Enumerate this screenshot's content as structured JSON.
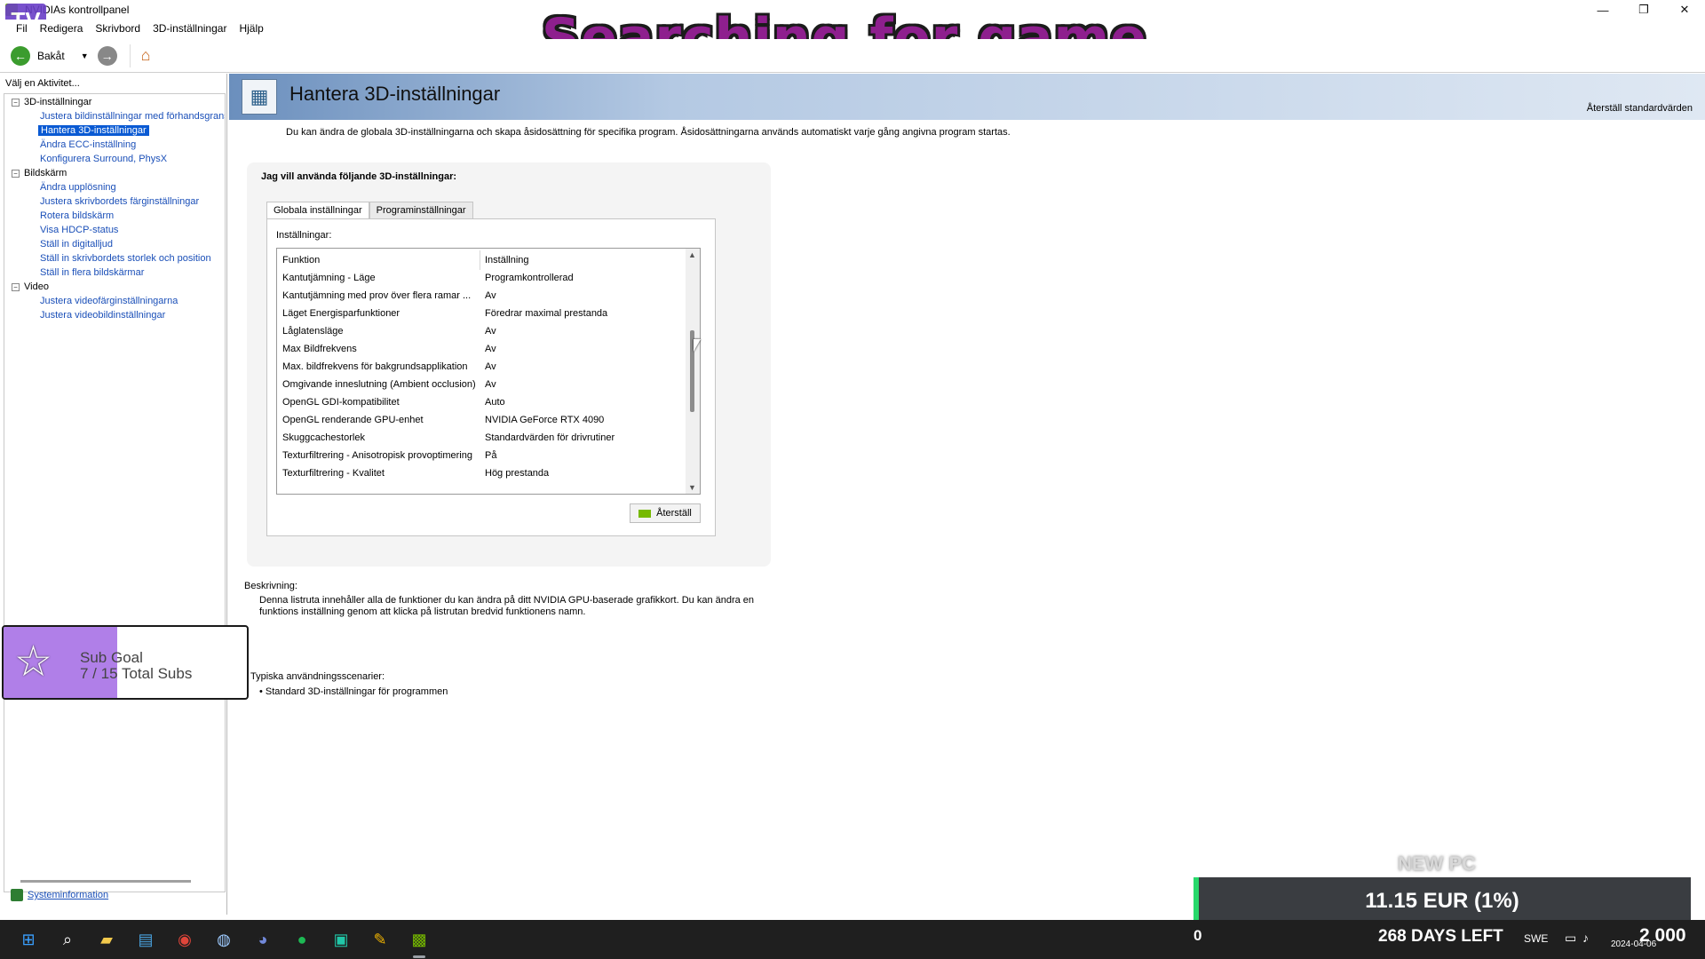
{
  "window": {
    "title": "NVIDIAs kontrollpanel",
    "controls": [
      "—",
      "❐",
      "✕"
    ]
  },
  "menu": [
    "Fil",
    "Redigera",
    "Skrivbord",
    "3D-inställningar",
    "Hjälp"
  ],
  "toolbar": {
    "back_label": "Bakåt"
  },
  "overlay": {
    "stream_title": "Searching for game",
    "twitch_logo": "TV"
  },
  "sidebar": {
    "task_label": "Välj en Aktivitet...",
    "tree": [
      {
        "label": "3D-inställningar",
        "type": "cat"
      },
      {
        "label": "Justera bildinställningar med förhandsgranskning",
        "type": "link"
      },
      {
        "label": "Hantera 3D-inställningar",
        "type": "selected"
      },
      {
        "label": "Ändra ECC-inställning",
        "type": "link"
      },
      {
        "label": "Konfigurera Surround, PhysX",
        "type": "link"
      },
      {
        "label": "Bildskärm",
        "type": "cat"
      },
      {
        "label": "Ändra upplösning",
        "type": "link"
      },
      {
        "label": "Justera skrivbordets färginställningar",
        "type": "link"
      },
      {
        "label": "Rotera bildskärm",
        "type": "link"
      },
      {
        "label": "Visa HDCP-status",
        "type": "link"
      },
      {
        "label": "Ställ in digitalljud",
        "type": "link"
      },
      {
        "label": "Ställ in skrivbordets storlek och position",
        "type": "link"
      },
      {
        "label": "Ställ in flera bildskärmar",
        "type": "link"
      },
      {
        "label": "Video",
        "type": "cat"
      },
      {
        "label": "Justera videofärginställningarna",
        "type": "link"
      },
      {
        "label": "Justera videobildinställningar",
        "type": "link"
      }
    ],
    "sysinfo": "Systeminformation"
  },
  "main": {
    "page_title": "Hantera 3D-inställningar",
    "restore_defaults": "Återställ standardvärden",
    "intro": "Du kan ändra de globala 3D-inställningarna och skapa åsidosättning för specifika program. Åsidosättningarna används automatiskt varje gång angivna program startas.",
    "card_heading": "Jag vill använda följande 3D-inställningar:",
    "tabs": [
      "Globala inställningar",
      "Programinställningar"
    ],
    "settings_label": "Inställningar:",
    "columns": {
      "function": "Funktion",
      "setting": "Inställning"
    },
    "rows": [
      {
        "function": "Kantutjämning - Läge",
        "setting": "Programkontrollerad"
      },
      {
        "function": "Kantutjämning med prov över flera ramar ...",
        "setting": "Av"
      },
      {
        "function": "Läget Energisparfunktioner",
        "setting": "Föredrar maximal prestanda"
      },
      {
        "function": "Låglatensläge",
        "setting": "Av"
      },
      {
        "function": "Max Bildfrekvens",
        "setting": "Av"
      },
      {
        "function": "Max. bildfrekvens för bakgrundsapplikation",
        "setting": "Av"
      },
      {
        "function": "Omgivande inneslutning (Ambient occlusion)",
        "setting": "Av"
      },
      {
        "function": "OpenGL GDI-kompatibilitet",
        "setting": "Auto"
      },
      {
        "function": "OpenGL renderande GPU-enhet",
        "setting": "NVIDIA GeForce RTX 4090"
      },
      {
        "function": "Skuggcachestorlek",
        "setting": "Standardvärden för drivrutiner"
      },
      {
        "function": "Texturfiltrering - Anisotropisk provoptimering",
        "setting": "På"
      },
      {
        "function": "Texturfiltrering - Kvalitet",
        "setting": "Hög prestanda"
      }
    ],
    "reset_button": "Återställ",
    "description_label": "Beskrivning:",
    "description_text": "Denna listruta innehåller alla de funktioner du kan ändra på ditt NVIDIA GPU-baserade grafikkort. Du kan ändra en funktions inställning genom att klicka på listrutan bredvid funktionens namn.",
    "usage_label": "Typiska användningsscenarier:",
    "usage_item": "• Standard 3D-inställningar för programmen"
  },
  "sub_goal": {
    "title": "Sub Goal",
    "count": "7 / 15 Total Subs",
    "progress": 0.4667
  },
  "pc_goal": {
    "label": "NEW PC",
    "amount": "11.15 EUR (1%)",
    "progress": 0.01
  },
  "taskbar": {
    "icons": [
      "windows-start-icon",
      "search-icon",
      "file-explorer-icon",
      "notepad-icon",
      "chrome-icon",
      "steam-icon",
      "discord-icon",
      "spotify-icon",
      "app-icon",
      "editor-icon",
      "nvidia-icon"
    ],
    "zero": "0",
    "days_left": "268 DAYS LEFT",
    "language": "SWE",
    "date": "2024-04-06",
    "count": "2 000"
  },
  "colors": {
    "accent_blue": "#0a5ad3",
    "nvidia_green": "#76b900",
    "sub_goal_fill": "#b07fe8",
    "stream_title": "#8e1f8e"
  }
}
